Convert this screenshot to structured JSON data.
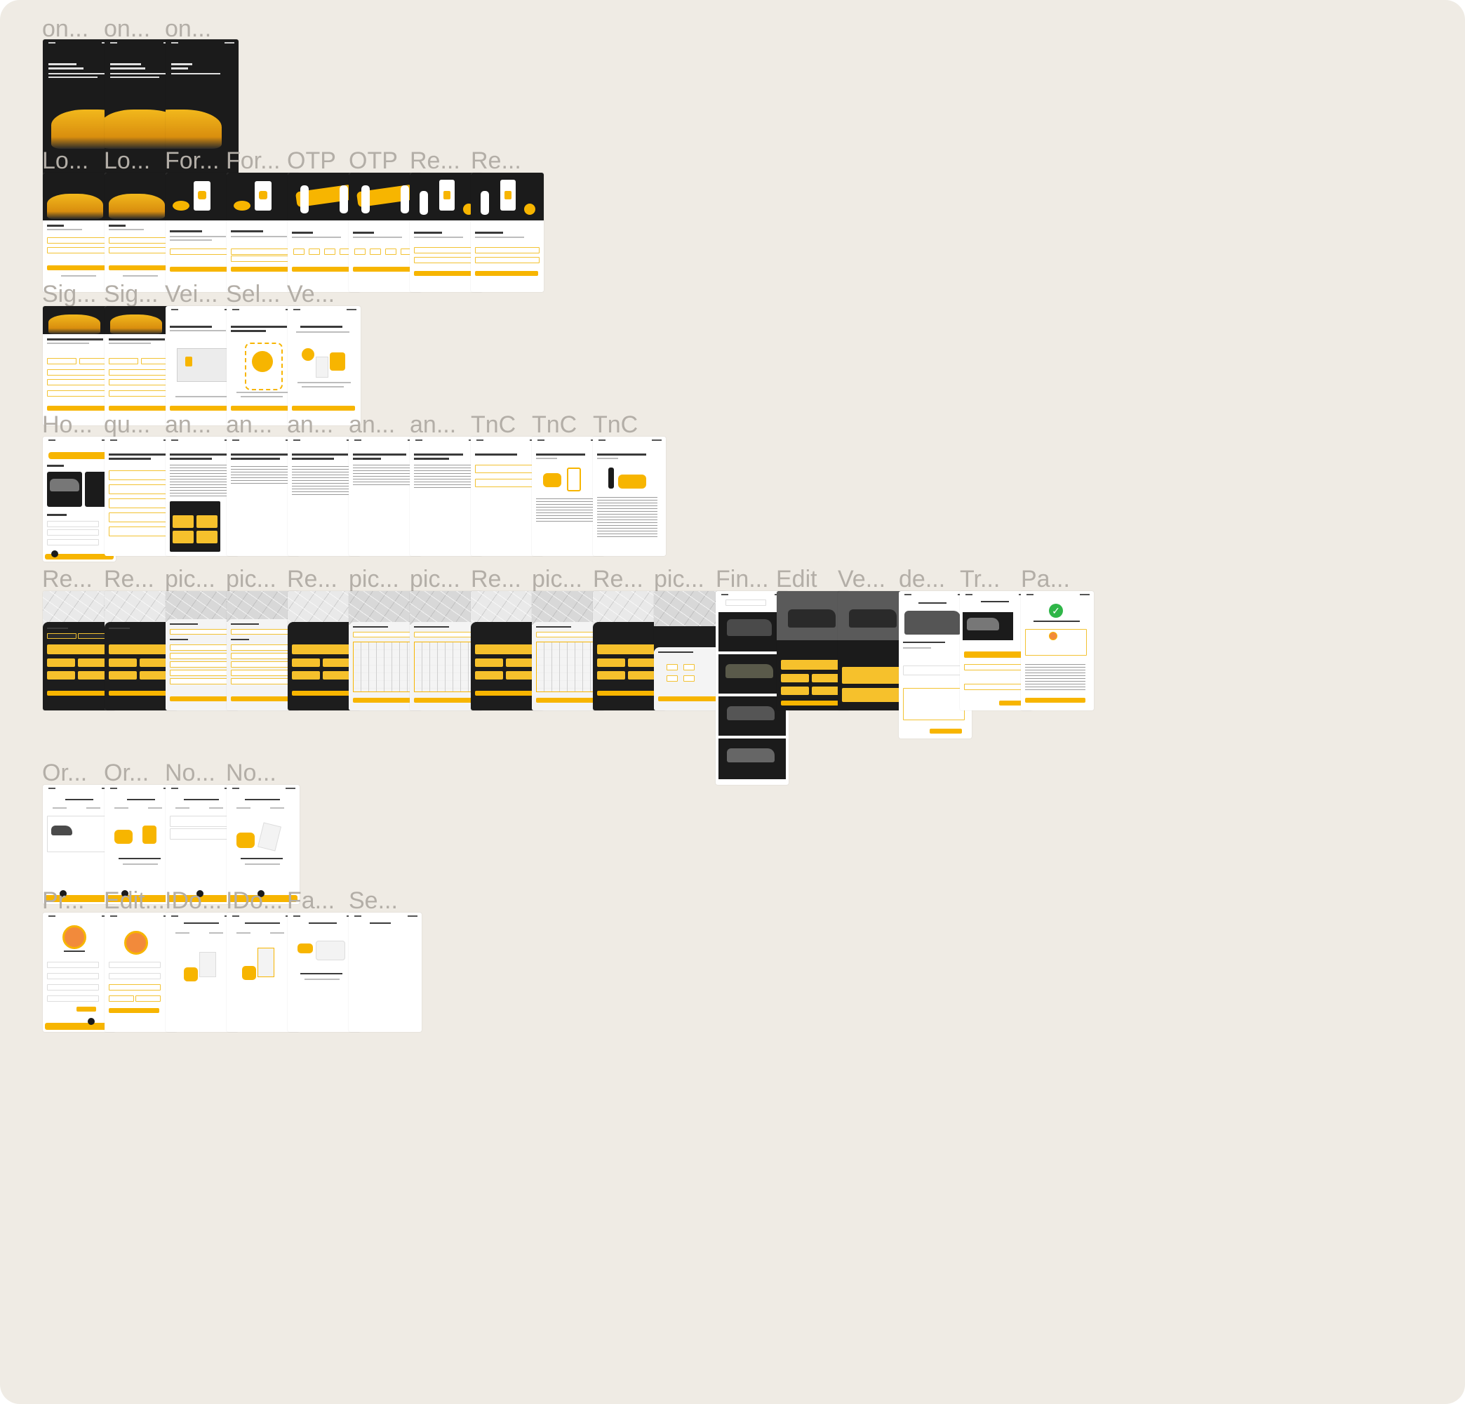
{
  "canvas": {
    "background": "#efebe4",
    "accent": "#f7b500",
    "dark": "#1b1b1b"
  },
  "rows": [
    {
      "labels": [
        "on...",
        "on...",
        "on..."
      ]
    },
    {
      "labels": [
        "Lo...",
        "Lo...",
        "For...",
        "For...",
        "OTP",
        "OTP",
        "Re...",
        "Re..."
      ]
    },
    {
      "labels": [
        "Sig...",
        "Sig...",
        "Vei...",
        "Sel...",
        "Ve..."
      ]
    },
    {
      "labels": [
        "Ho...",
        "qu...",
        "an...",
        "an...",
        "an...",
        "an...",
        "an...",
        "TnC",
        "TnC",
        "TnC"
      ]
    },
    {
      "labels": [
        "Re...",
        "Re...",
        "pic...",
        "pic...",
        "Re...",
        "pic...",
        "pic...",
        "Re...",
        "pic...",
        "Re...",
        "pic...",
        "Fin...",
        "Edit",
        "Ve...",
        "de...",
        "Tr...",
        "Pa..."
      ]
    },
    {
      "labels": [
        "Or...",
        "Or...",
        "No...",
        "No..."
      ]
    },
    {
      "labels": [
        "Pr...",
        "Edit...",
        "IDo...",
        "IDo...",
        "Fa...",
        "Se..."
      ]
    }
  ],
  "icons": [
    "check-icon",
    "avatar-icon",
    "car-image",
    "map-image"
  ],
  "payment": {
    "check_glyph": "✓"
  }
}
